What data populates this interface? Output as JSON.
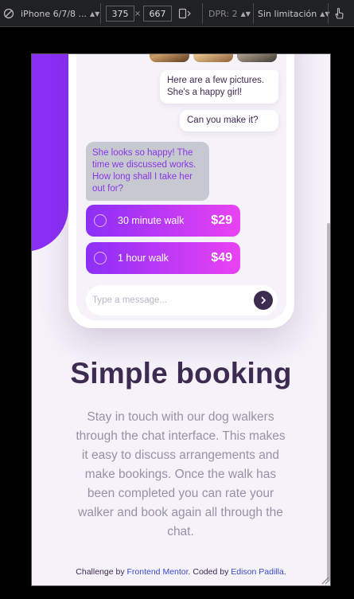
{
  "devtools": {
    "device": "iPhone 6/7/8 ...",
    "width": "375",
    "times": "×",
    "height": "667",
    "dpr": "DPR: 2",
    "throttle": "Sin limitación"
  },
  "chat": {
    "out_1": "Here are a few pictures. She's a happy girl!",
    "out_2": "Can you make it?",
    "in_1": "She looks so happy! The time we discussed works. How long shall I take her out for?",
    "options": [
      {
        "label": "30 minute walk",
        "price": "$29"
      },
      {
        "label": "1 hour walk",
        "price": "$49"
      }
    ],
    "message_placeholder": "Type a message..."
  },
  "headline": "Simple booking",
  "description": "Stay in touch with our dog walkers through the chat interface. This makes it easy to discuss arrangements and make bookings. Once the walk has been completed you can rate your walker and book again all through the chat.",
  "footer": {
    "prefix": "Challenge by ",
    "fm": "Frontend Mentor",
    "middle": ". Coded by ",
    "author": "Edison Padilla",
    "suffix": "."
  },
  "colors": {
    "accent_purple": "#8c2ff6",
    "accent_pink": "#e943f2",
    "dark_text": "#3e2b52",
    "muted_text": "#9692a4",
    "background": "#f5f2fa"
  }
}
